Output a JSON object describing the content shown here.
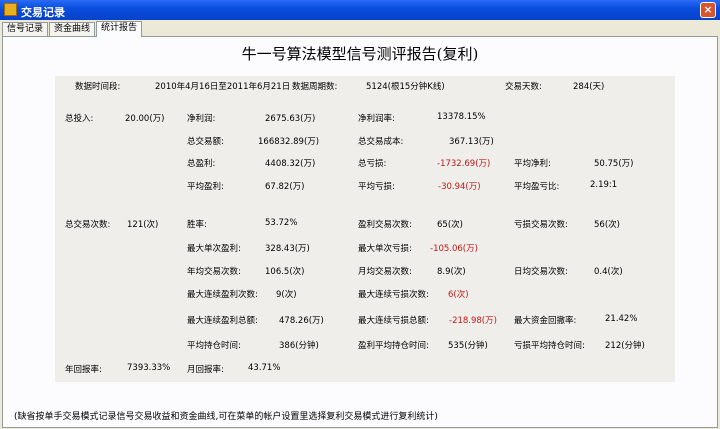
{
  "window": {
    "title": "交易记录",
    "close_glyph": "×"
  },
  "tabs": [
    "信号记录",
    "资金曲线",
    "统计报告"
  ],
  "report": {
    "title": "牛一号算法模型信号测评报告(复利)",
    "period_label": "数据时间段:",
    "period_value": "2010年4月16日至2011年6月21日",
    "cycles_label": "数据周期数:",
    "cycles_value": "5124(根15分钟K线)",
    "trade_days_label": "交易天数:",
    "trade_days_value": "284(天)",
    "total_investment_label": "总投入:",
    "total_investment_value": "20.00(万)",
    "net_profit_label": "净利润:",
    "net_profit_value": "2675.63(万)",
    "net_profit_rate_label": "净利润率:",
    "net_profit_rate_value": "13378.15%",
    "total_volume_label": "总交易额:",
    "total_volume_value": "166832.89(万)",
    "total_cost_label": "总交易成本:",
    "total_cost_value": "367.13(万)",
    "total_profit_label": "总盈利:",
    "total_profit_value": "4408.32(万)",
    "total_loss_label": "总亏损:",
    "total_loss_value": "-1732.69(万)",
    "avg_net_label": "平均净利:",
    "avg_net_value": "50.75(万)",
    "avg_profit_label": "平均盈利:",
    "avg_profit_value": "67.82(万)",
    "avg_loss_label": "平均亏损:",
    "avg_loss_value": "-30.94(万)",
    "pl_ratio_label": "平均盈亏比:",
    "pl_ratio_value": "2.19:1",
    "total_trades_label": "总交易次数:",
    "total_trades_value": "121(次)",
    "win_rate_label": "胜率:",
    "win_rate_value": "53.72%",
    "win_trades_label": "盈利交易次数:",
    "win_trades_value": "65(次)",
    "loss_trades_label": "亏损交易次数:",
    "loss_trades_value": "56(次)",
    "max_single_profit_label": "最大单次盈利:",
    "max_single_profit_value": "328.43(万)",
    "max_single_loss_label": "最大单次亏损:",
    "max_single_loss_value": "-105.06(万)",
    "yearly_trades_label": "年均交易次数:",
    "yearly_trades_value": "106.5(次)",
    "monthly_trades_label": "月均交易次数:",
    "monthly_trades_value": "8.9(次)",
    "daily_trades_label": "日均交易次数:",
    "daily_trades_value": "0.4(次)",
    "max_consec_win_label": "最大连续盈利次数:",
    "max_consec_win_value": "9(次)",
    "max_consec_loss_label": "最大连续亏损次数:",
    "max_consec_loss_value": "6(次)",
    "max_consec_win_amt_label": "最大连续盈利总额:",
    "max_consec_win_amt_value": "478.26(万)",
    "max_consec_loss_amt_label": "最大连续亏损总额:",
    "max_consec_loss_amt_value": "-218.98(万)",
    "max_drawdown_label": "最大资金回撤率:",
    "max_drawdown_value": "21.42%",
    "avg_hold_label": "平均持仓时间:",
    "avg_hold_value": "386(分钟)",
    "win_hold_label": "盈利平均持仓时间:",
    "win_hold_value": "535(分钟)",
    "loss_hold_label": "亏损平均持仓时间:",
    "loss_hold_value": "212(分钟)",
    "annual_return_label": "年回报率:",
    "annual_return_value": "7393.33%",
    "monthly_return_label": "月回报率:",
    "monthly_return_value": "43.71%"
  },
  "status": "(缺省按单手交易模式记录信号交易收益和资金曲线,可在菜单的帐户设置里选择复利交易模式进行复利统计)"
}
